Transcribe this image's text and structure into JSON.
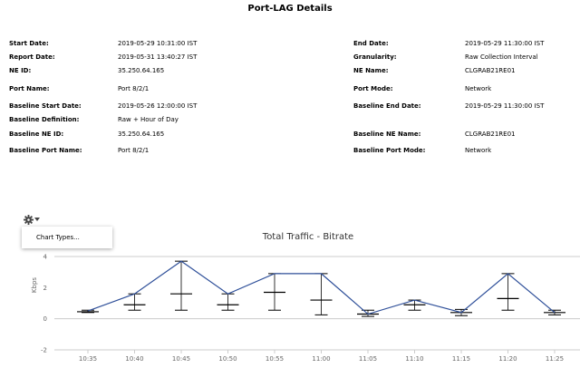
{
  "report": {
    "title": "Port-LAG Details",
    "left": [
      {
        "label": "Start Date:",
        "value": "2019-05-29 10:31:00 IST"
      },
      {
        "label": "Report Date:",
        "value": "2019-05-31 13:40:27 IST"
      },
      {
        "label": "NE ID:",
        "value": "35.250.64.165"
      },
      {
        "label": "Port Name:",
        "value": "Port 8/2/1"
      },
      {
        "label": "Baseline Start Date:",
        "value": "2019-05-26 12:00:00 IST"
      },
      {
        "label": "Baseline Definition:",
        "value": "Raw + Hour of Day"
      },
      {
        "label": "Baseline NE ID:",
        "value": "35.250.64.165"
      },
      {
        "label": "Baseline Port Name:",
        "value": "Port 8/2/1"
      }
    ],
    "right": [
      {
        "label": "End Date:",
        "value": "2019-05-29 11:30:00 IST"
      },
      {
        "label": "Granularity:",
        "value": "Raw Collection Interval"
      },
      {
        "label": "NE Name:",
        "value": "CLGRAB21RE01"
      },
      {
        "label": "Port Mode:",
        "value": "Network"
      },
      {
        "label": "Baseline End Date:",
        "value": "2019-05-29 11:30:00 IST"
      },
      {
        "label": "Baseline NE Name:",
        "value": "CLGRAB21RE01"
      },
      {
        "label": "Baseline Port Mode:",
        "value": "Network"
      }
    ]
  },
  "toolbar": {
    "gear_icon": "gear-icon",
    "caret_icon": "caret-down-icon",
    "menu_items": [
      "Chart Types..."
    ]
  },
  "chart_data": {
    "type": "line",
    "title": "Total Traffic - Bitrate",
    "ylabel": "Kbps",
    "xlabel": "",
    "ylim": [
      -2,
      4
    ],
    "yticks": [
      "4",
      "2",
      "0",
      "-2"
    ],
    "categories": [
      "10:35",
      "10:40",
      "10:45",
      "10:50",
      "10:55",
      "11:00",
      "11:05",
      "11:10",
      "11:15",
      "11:20",
      "11:25"
    ],
    "series": [
      {
        "values": [
          0.5,
          1.6,
          3.7,
          1.6,
          2.9,
          2.9,
          0.3,
          1.2,
          0.4,
          2.9,
          0.4
        ],
        "color": "#2e4f99"
      }
    ],
    "baseline_bands": [
      {
        "low": 0.4,
        "mid": 0.45,
        "high": 0.55
      },
      {
        "low": 0.55,
        "mid": 0.9,
        "high": 1.6
      },
      {
        "low": 0.55,
        "mid": 1.6,
        "high": 3.7
      },
      {
        "low": 0.55,
        "mid": 0.9,
        "high": 1.6
      },
      {
        "low": 0.55,
        "mid": 1.7,
        "high": 2.9
      },
      {
        "low": 0.25,
        "mid": 1.2,
        "high": 2.9
      },
      {
        "low": 0.15,
        "mid": 0.3,
        "high": 0.55
      },
      {
        "low": 0.55,
        "mid": 0.9,
        "high": 1.2
      },
      {
        "low": 0.2,
        "mid": 0.4,
        "high": 0.6
      },
      {
        "low": 0.55,
        "mid": 1.3,
        "high": 2.9
      },
      {
        "low": 0.25,
        "mid": 0.4,
        "high": 0.55
      }
    ],
    "grid": false,
    "colors": {
      "line": "#2e4f99",
      "baseline": "#000000",
      "axis": "#cccccc"
    }
  }
}
